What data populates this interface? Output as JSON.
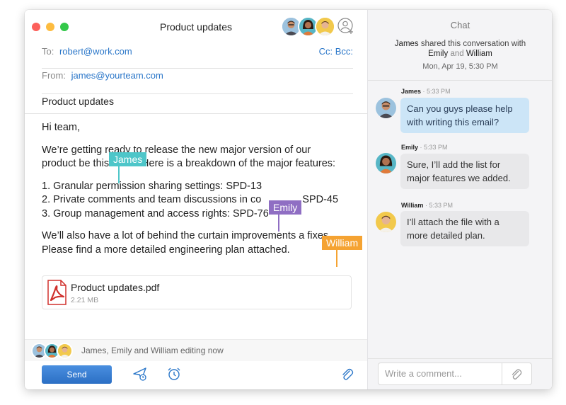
{
  "window": {
    "title": "Product updates"
  },
  "compose": {
    "to_label": "To:",
    "to_value": "robert@work.com",
    "cc_bcc": "Cc: Bcc:",
    "from_label": "From:",
    "from_value": "james@yourteam.com",
    "subject": "Product updates",
    "body": {
      "greeting": "Hi team,",
      "para1": "We’re getting ready to release the new major version of our product be this week. Here is a breakdown of the major features:",
      "items": [
        "1. Granular permission sharing settings: SPD-13",
        "2. Private comments and team discussions in co",
        "3. Group management and access rights: SPD-76"
      ],
      "item2_tail": "SPD-45",
      "para2": "We’ll also have a lot of behind the curtain improvements a fixes. Please find a more detailed engineering plan attached."
    },
    "cursors": [
      {
        "name": "James",
        "color": "#4ec6c9"
      },
      {
        "name": "Emily",
        "color": "#8f6ec3"
      },
      {
        "name": "William",
        "color": "#f5a332"
      }
    ],
    "attachment": {
      "name": "Product updates.pdf",
      "size": "2.21 MB",
      "icon": "pdf-icon"
    },
    "collaborators_text": "James, Emily and William editing now",
    "send_label": "Send"
  },
  "chat": {
    "title": "Chat",
    "share": {
      "sharer": "James",
      "text": "shared this conversation with",
      "person1": "Emily",
      "and": "and",
      "person2": "William",
      "date": "Mon, Apr 19, 5:30 PM"
    },
    "messages": [
      {
        "author": "James",
        "time": "· 5:33 PM",
        "text": "Can you guys please help with writing this email?",
        "mine": true
      },
      {
        "author": "Emily",
        "time": "· 5:33 PM",
        "text": "Sure, I’ll add the list for major features we added.",
        "mine": false
      },
      {
        "author": "William",
        "time": "· 5:33 PM",
        "text": "I’ll attach the file with a more detailed plan.",
        "mine": false
      }
    ],
    "input_placeholder": "Write a comment..."
  },
  "colors": {
    "accent": "#2b77c9",
    "james": "#4ec6c9",
    "emily": "#8f6ec3",
    "william": "#f5a332",
    "pdf": "#d0312d"
  }
}
